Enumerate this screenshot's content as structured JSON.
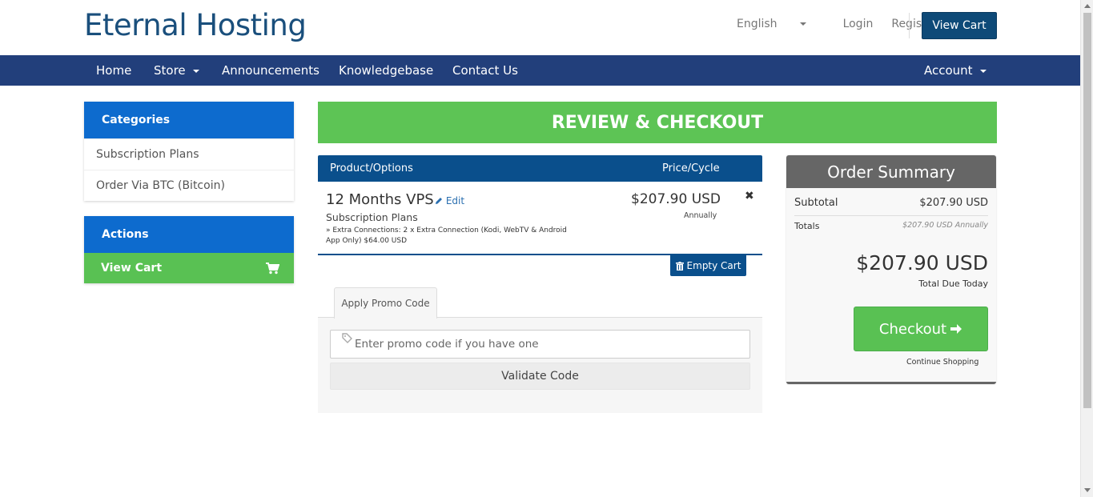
{
  "header": {
    "logo": "Eternal Hosting",
    "language": "English",
    "login": "Login",
    "register": "Register",
    "view_cart": "View Cart"
  },
  "nav": {
    "home": "Home",
    "store": "Store",
    "announcements": "Announcements",
    "knowledgebase": "Knowledgebase",
    "contact": "Contact Us",
    "account": "Account"
  },
  "sidebar": {
    "categories_title": "Categories",
    "categories": [
      "Subscription Plans",
      "Order Via BTC (Bitcoin)"
    ],
    "actions_title": "Actions",
    "view_cart": "View Cart"
  },
  "main": {
    "banner": "REVIEW & CHECKOUT",
    "col_product": "Product/Options",
    "col_price": "Price/Cycle",
    "item": {
      "name": "12 Months VPS",
      "edit": "Edit",
      "group": "Subscription Plans",
      "option": "» Extra Connections: 2 x Extra Connection (Kodi, WebTV & Android App Only) $64.00 USD",
      "price": "$207.90 USD",
      "cycle": "Annually"
    },
    "empty_cart": "Empty Cart",
    "promo_tab": "Apply Promo Code",
    "promo_placeholder": "Enter promo code if you have one",
    "validate": "Validate Code"
  },
  "summary": {
    "title": "Order Summary",
    "subtotal_label": "Subtotal",
    "subtotal_value": "$207.90 USD",
    "totals_label": "Totals",
    "totals_value": "$207.90 USD Annually",
    "total_due": "$207.90 USD",
    "total_due_label": "Total Due Today",
    "checkout": "Checkout",
    "continue": "Continue Shopping"
  },
  "colors": {
    "brand_blue": "#0a4f8c",
    "nav_blue": "#223f7b",
    "green": "#59c153",
    "summary_gray": "#666666"
  }
}
